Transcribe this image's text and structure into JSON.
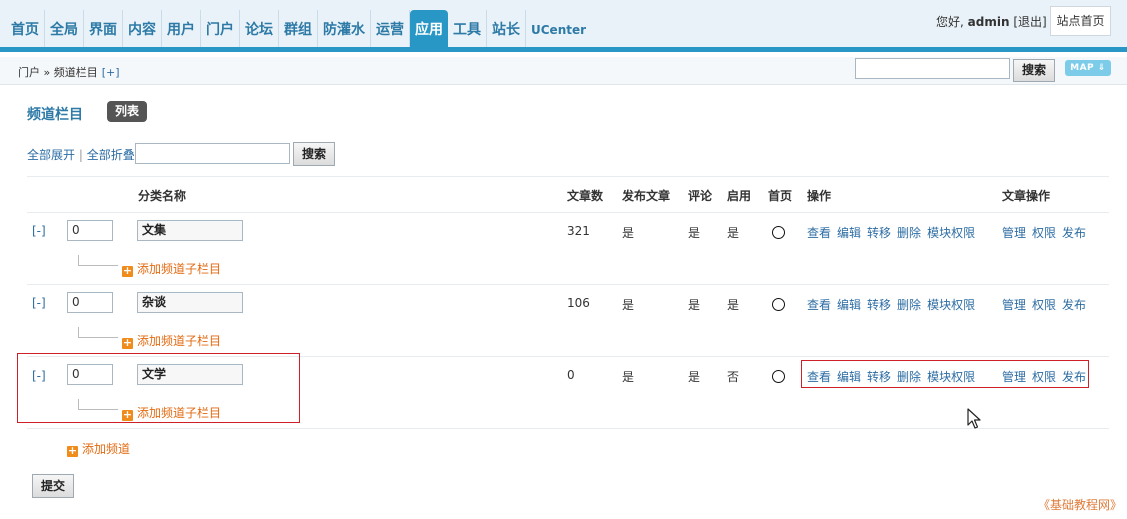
{
  "nav": {
    "items": [
      "首页",
      "全局",
      "界面",
      "内容",
      "用户",
      "门户",
      "论坛",
      "群组",
      "防灌水",
      "运营",
      "应用",
      "工具",
      "站长",
      "UCenter"
    ],
    "active": "应用"
  },
  "header": {
    "greeting_prefix": "您好, ",
    "username": "admin",
    "logout": "[退出]",
    "site_home": "站点首页"
  },
  "breadcrumb": {
    "text": "门户 » 频道栏目",
    "add": "[+]"
  },
  "top_search": {
    "value": "",
    "button": "搜索",
    "map": "MAP ⇓"
  },
  "page": {
    "title": "频道栏目",
    "badge": "列表"
  },
  "filters": {
    "expand_all": "全部展开",
    "separator": "|",
    "collapse_all": "全部折叠",
    "search_value": "",
    "search_button": "搜索"
  },
  "table": {
    "headers": {
      "name": "分类名称",
      "articles": "文章数",
      "publish": "发布文章",
      "comment": "评论",
      "enabled": "启用",
      "homepage": "首页",
      "operations": "操作",
      "article_ops": "文章操作"
    },
    "rows": [
      {
        "toggle": "[-]",
        "order": "0",
        "name": "文集",
        "articles": "321",
        "publish": "是",
        "comment": "是",
        "enabled": "是"
      },
      {
        "toggle": "[-]",
        "order": "0",
        "name": "杂谈",
        "articles": "106",
        "publish": "是",
        "comment": "是",
        "enabled": "是"
      },
      {
        "toggle": "[-]",
        "order": "0",
        "name": "文学",
        "articles": "0",
        "publish": "是",
        "comment": "是",
        "enabled": "否"
      }
    ],
    "ops": [
      "查看",
      "编辑",
      "转移",
      "删除",
      "模块权限"
    ],
    "article_ops": [
      "管理",
      "权限",
      "发布"
    ],
    "add_sub": "添加频道子栏目",
    "add_channel": "添加频道"
  },
  "submit": "提交",
  "watermark": "《基础教程网》"
}
